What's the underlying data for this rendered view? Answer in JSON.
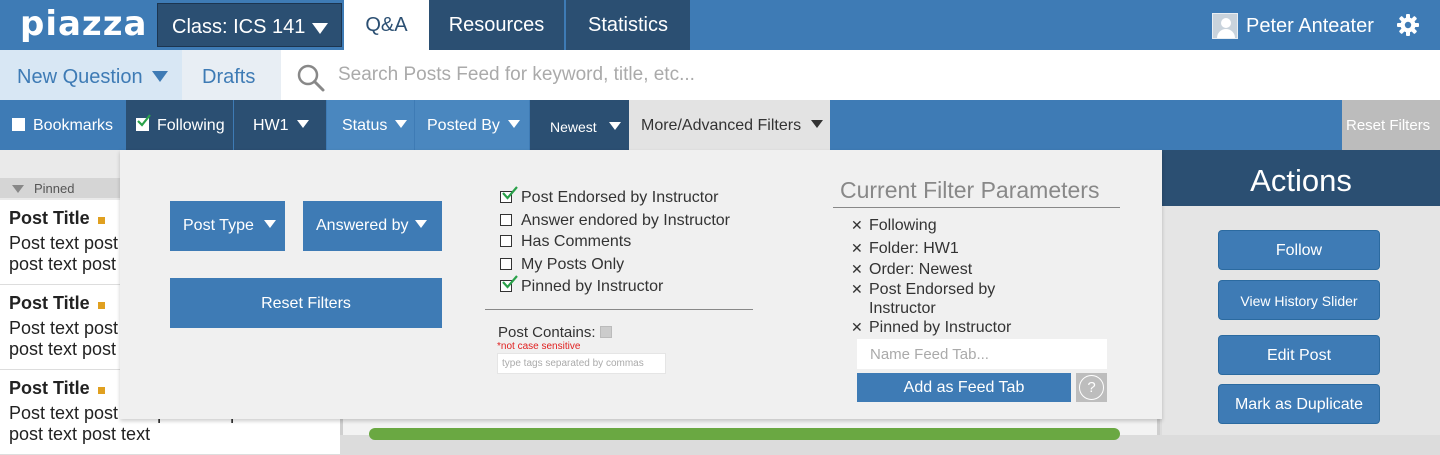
{
  "topbar": {
    "logo": "piazza",
    "class_selector": "Class: ICS 141",
    "tabs": [
      "Q&A",
      "Resources",
      "Statistics"
    ],
    "user_name": "Peter Anteater"
  },
  "row2": {
    "new_question": "New Question",
    "drafts": "Drafts",
    "search_placeholder": "Search Posts Feed for keyword, title, etc..."
  },
  "filters": {
    "bookmarks": "Bookmarks",
    "following": "Following",
    "folder": "HW1",
    "status": "Status",
    "posted_by": "Posted By",
    "order": "Newest",
    "advanced": "More/Advanced Filters",
    "reset": "Reset Filters"
  },
  "feed": {
    "pinned_label": "Pinned",
    "posts": [
      {
        "title": "Post Title",
        "text": "Post text post text post text post text post text post text"
      },
      {
        "title": "Post Title",
        "text": "Post text post text post text post text post text post text"
      },
      {
        "title": "Post Title",
        "text": "Post text post text post text post text post text post text"
      }
    ]
  },
  "panel": {
    "post_type": "Post Type",
    "answered_by": "Answered by",
    "reset_filters": "Reset Filters",
    "checkboxes": [
      {
        "label": "Post Endorsed by Instructor",
        "checked": true
      },
      {
        "label": "Answer endored by Instructor",
        "checked": false
      },
      {
        "label": "Has Comments",
        "checked": false
      },
      {
        "label": "My Posts Only",
        "checked": false
      },
      {
        "label": "Pinned by Instructor",
        "checked": true
      }
    ],
    "post_contains_label": "Post Contains:",
    "case_note": "*not case sensitive",
    "tags_placeholder": "type tags separated by commas",
    "current_filter_title": "Current Filter Parameters",
    "current_filters": [
      "Following",
      "Folder: HW1",
      "Order: Newest",
      "Post Endorsed by Instructor",
      "Pinned by Instructor"
    ],
    "feed_tab_placeholder": "Name Feed Tab...",
    "add_feed_tab": "Add as Feed Tab",
    "help": "?"
  },
  "actions": {
    "title": "Actions",
    "buttons": [
      "Follow",
      "View History Slider",
      "Edit Post",
      "Mark as Duplicate"
    ]
  },
  "colors": {
    "brand_blue": "#3e7bb5",
    "dark_navy": "#2b4f72",
    "check_green": "#2aa14a",
    "note_red": "#e02020"
  }
}
